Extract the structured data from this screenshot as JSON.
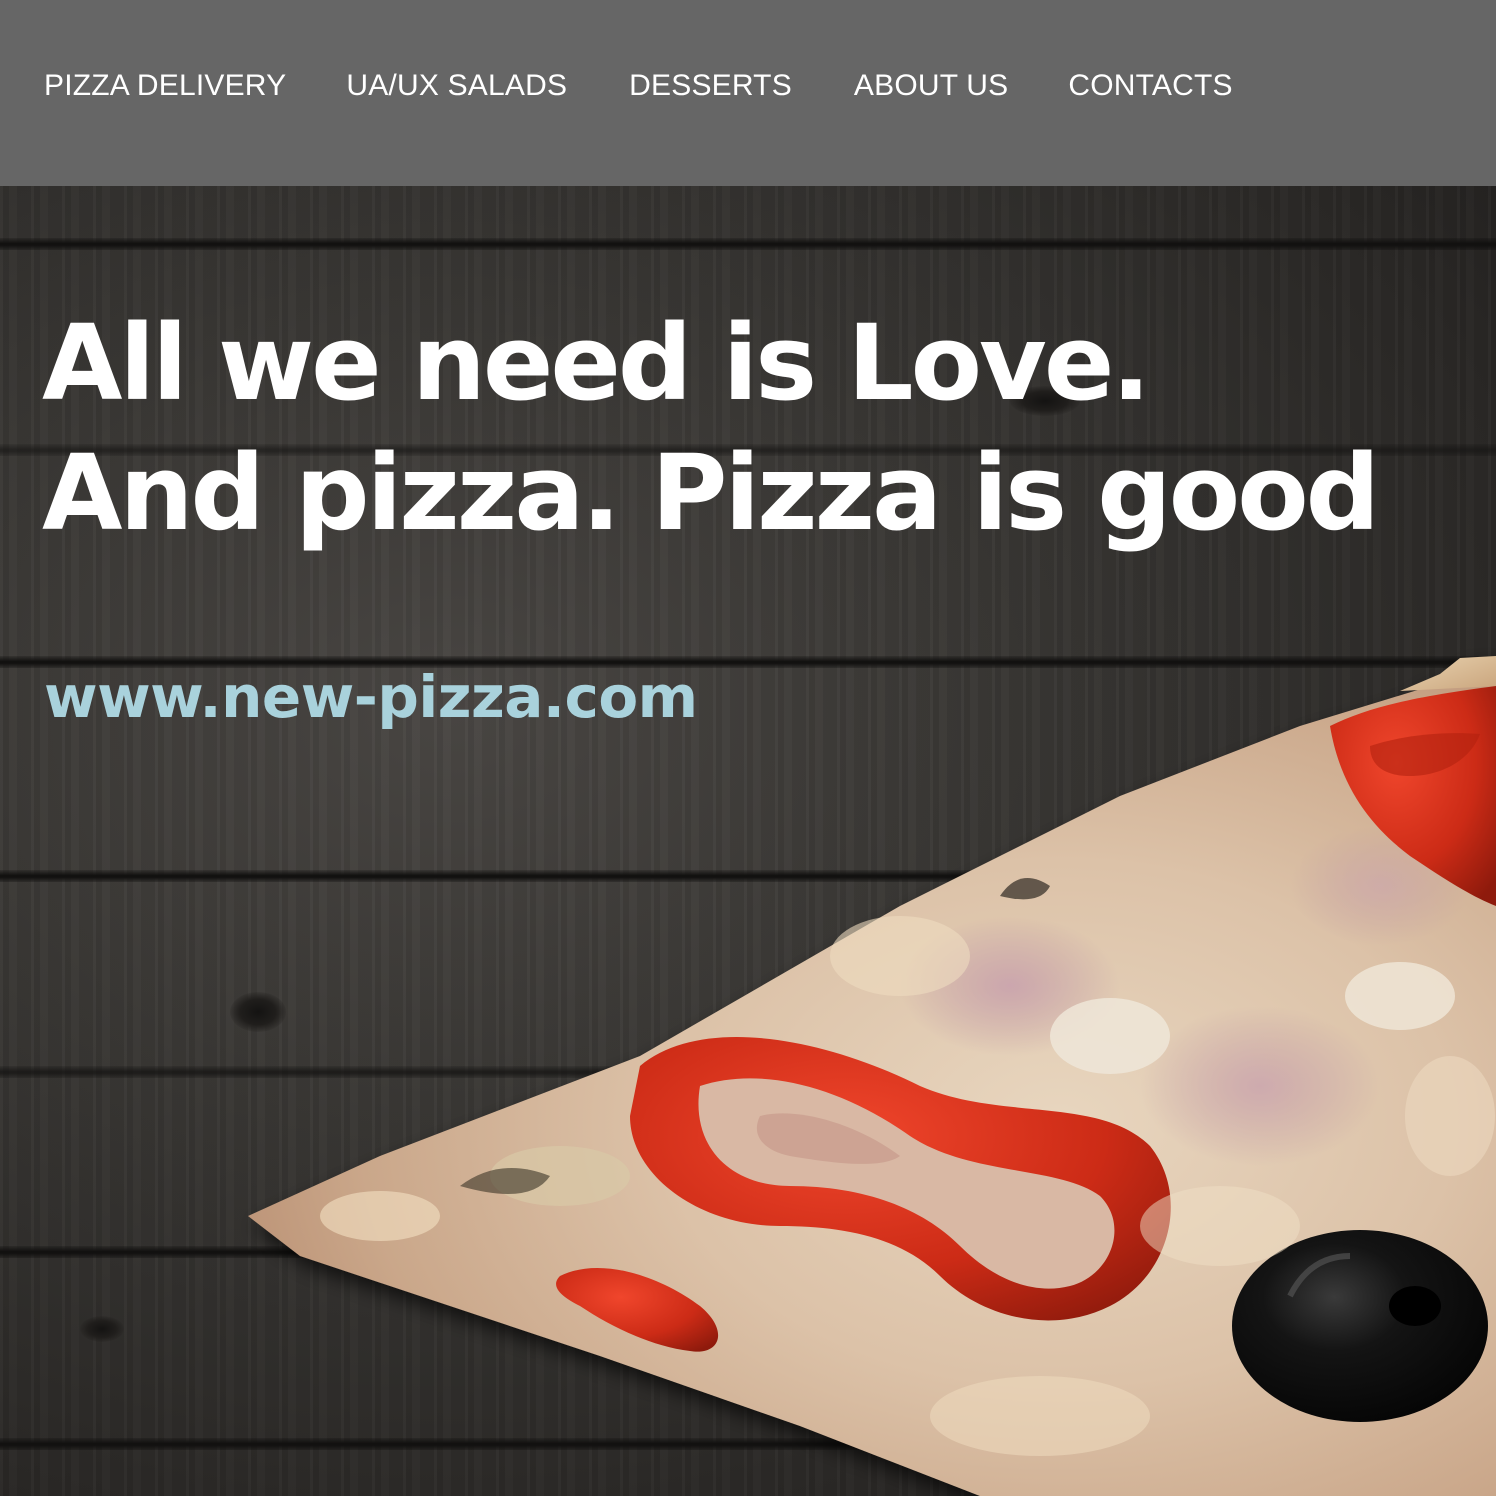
{
  "nav": {
    "items": [
      {
        "label": "PIZZA DELIVERY"
      },
      {
        "label": "UA/UX SALADS"
      },
      {
        "label": "DESSERTS"
      },
      {
        "label": "ABOUT US"
      },
      {
        "label": "CONTACTS"
      }
    ]
  },
  "hero": {
    "headline_line1": "All we need is Love.",
    "headline_line2": "And pizza. Pizza is good",
    "url": "www.new-pizza.com"
  },
  "colors": {
    "nav_background": "#666666",
    "nav_text": "#ffffff",
    "headline_text": "#ffffff",
    "url_text": "#a9d2dc",
    "wood_background": "#2f2d2b"
  },
  "icons": {
    "hero_image": "pizza-slice-image"
  }
}
